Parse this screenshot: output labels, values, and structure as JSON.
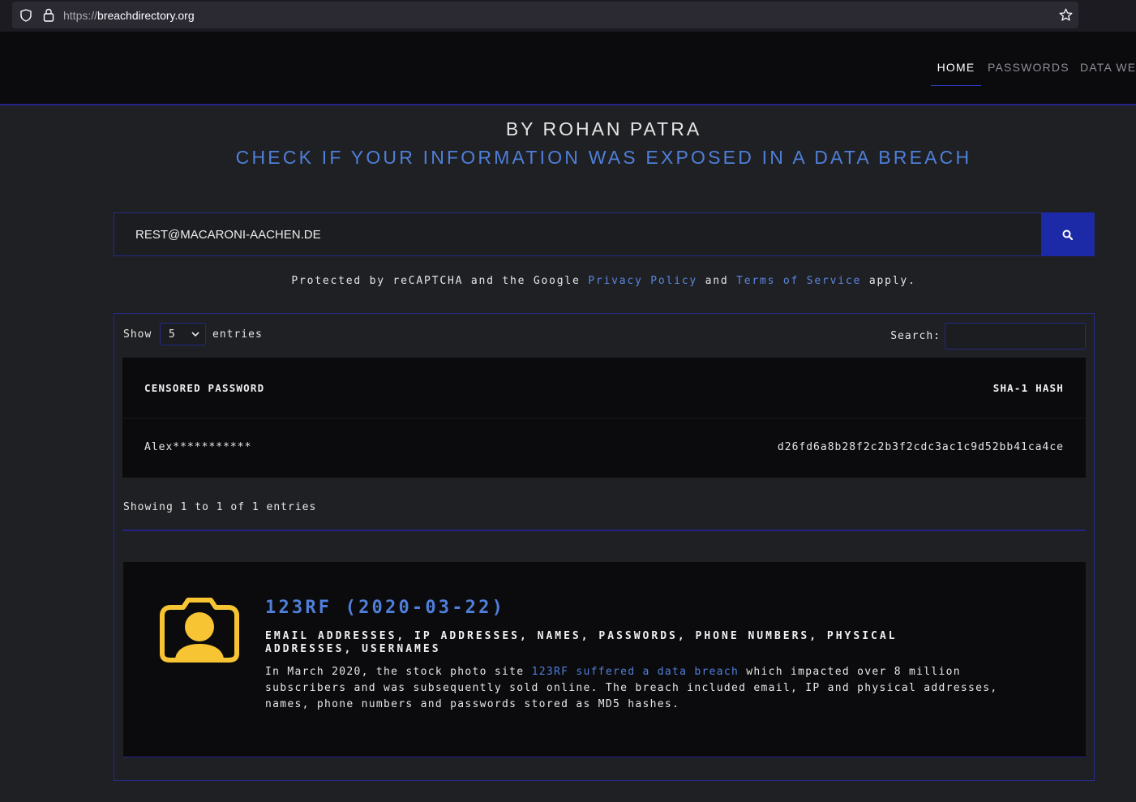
{
  "browser": {
    "url_protocol": "https://",
    "url_host": "breachdirectory.org"
  },
  "nav": {
    "items": [
      {
        "label": "HOME",
        "active": true
      },
      {
        "label": "PASSWORDS",
        "active": false
      },
      {
        "label": "DATA WE",
        "active": false
      }
    ]
  },
  "header": {
    "author": "BY ROHAN PATRA",
    "tagline": "CHECK IF YOUR INFORMATION WAS EXPOSED IN A DATA BREACH"
  },
  "search": {
    "value": "REST@MACARONI-AACHEN.DE",
    "button_icon": "search-icon"
  },
  "recaptcha": {
    "prefix": "Protected by reCAPTCHA and the Google ",
    "privacy_link": "Privacy Policy",
    "middle": " and ",
    "terms_link": "Terms of Service",
    "suffix": " apply."
  },
  "results": {
    "show_label": "Show",
    "page_size": "5",
    "entries_label": "entries",
    "search_label": "Search:",
    "columns": [
      "CENSORED PASSWORD",
      "SHA-1 HASH"
    ],
    "rows": [
      {
        "password": "Alex***********",
        "hash": "d26fd6a8b28f2c2b3f2cdc3ac1c9d52bb41ca4ce"
      }
    ],
    "showing": "Showing 1 to 1 of 1 entries"
  },
  "breach": {
    "title": "123RF (2020-03-22)",
    "data_classes": "EMAIL ADDRESSES, IP ADDRESSES, NAMES, PASSWORDS, PHONE NUMBERS, PHYSICAL ADDRESSES, USERNAMES",
    "desc_prefix": "In March 2020, the stock photo site ",
    "desc_link": "123RF suffered a data breach",
    "desc_suffix": " which impacted over 8 million subscribers and was subsequently sold online. The breach included email, IP and physical addresses, names, phone numbers and passwords stored as MD5 hashes.",
    "icon": "camera-avatar-icon",
    "icon_color": "#f7c533"
  },
  "colors": {
    "accent": "#4f7fd9",
    "border": "#262a8a",
    "button": "#1d2aa8"
  }
}
